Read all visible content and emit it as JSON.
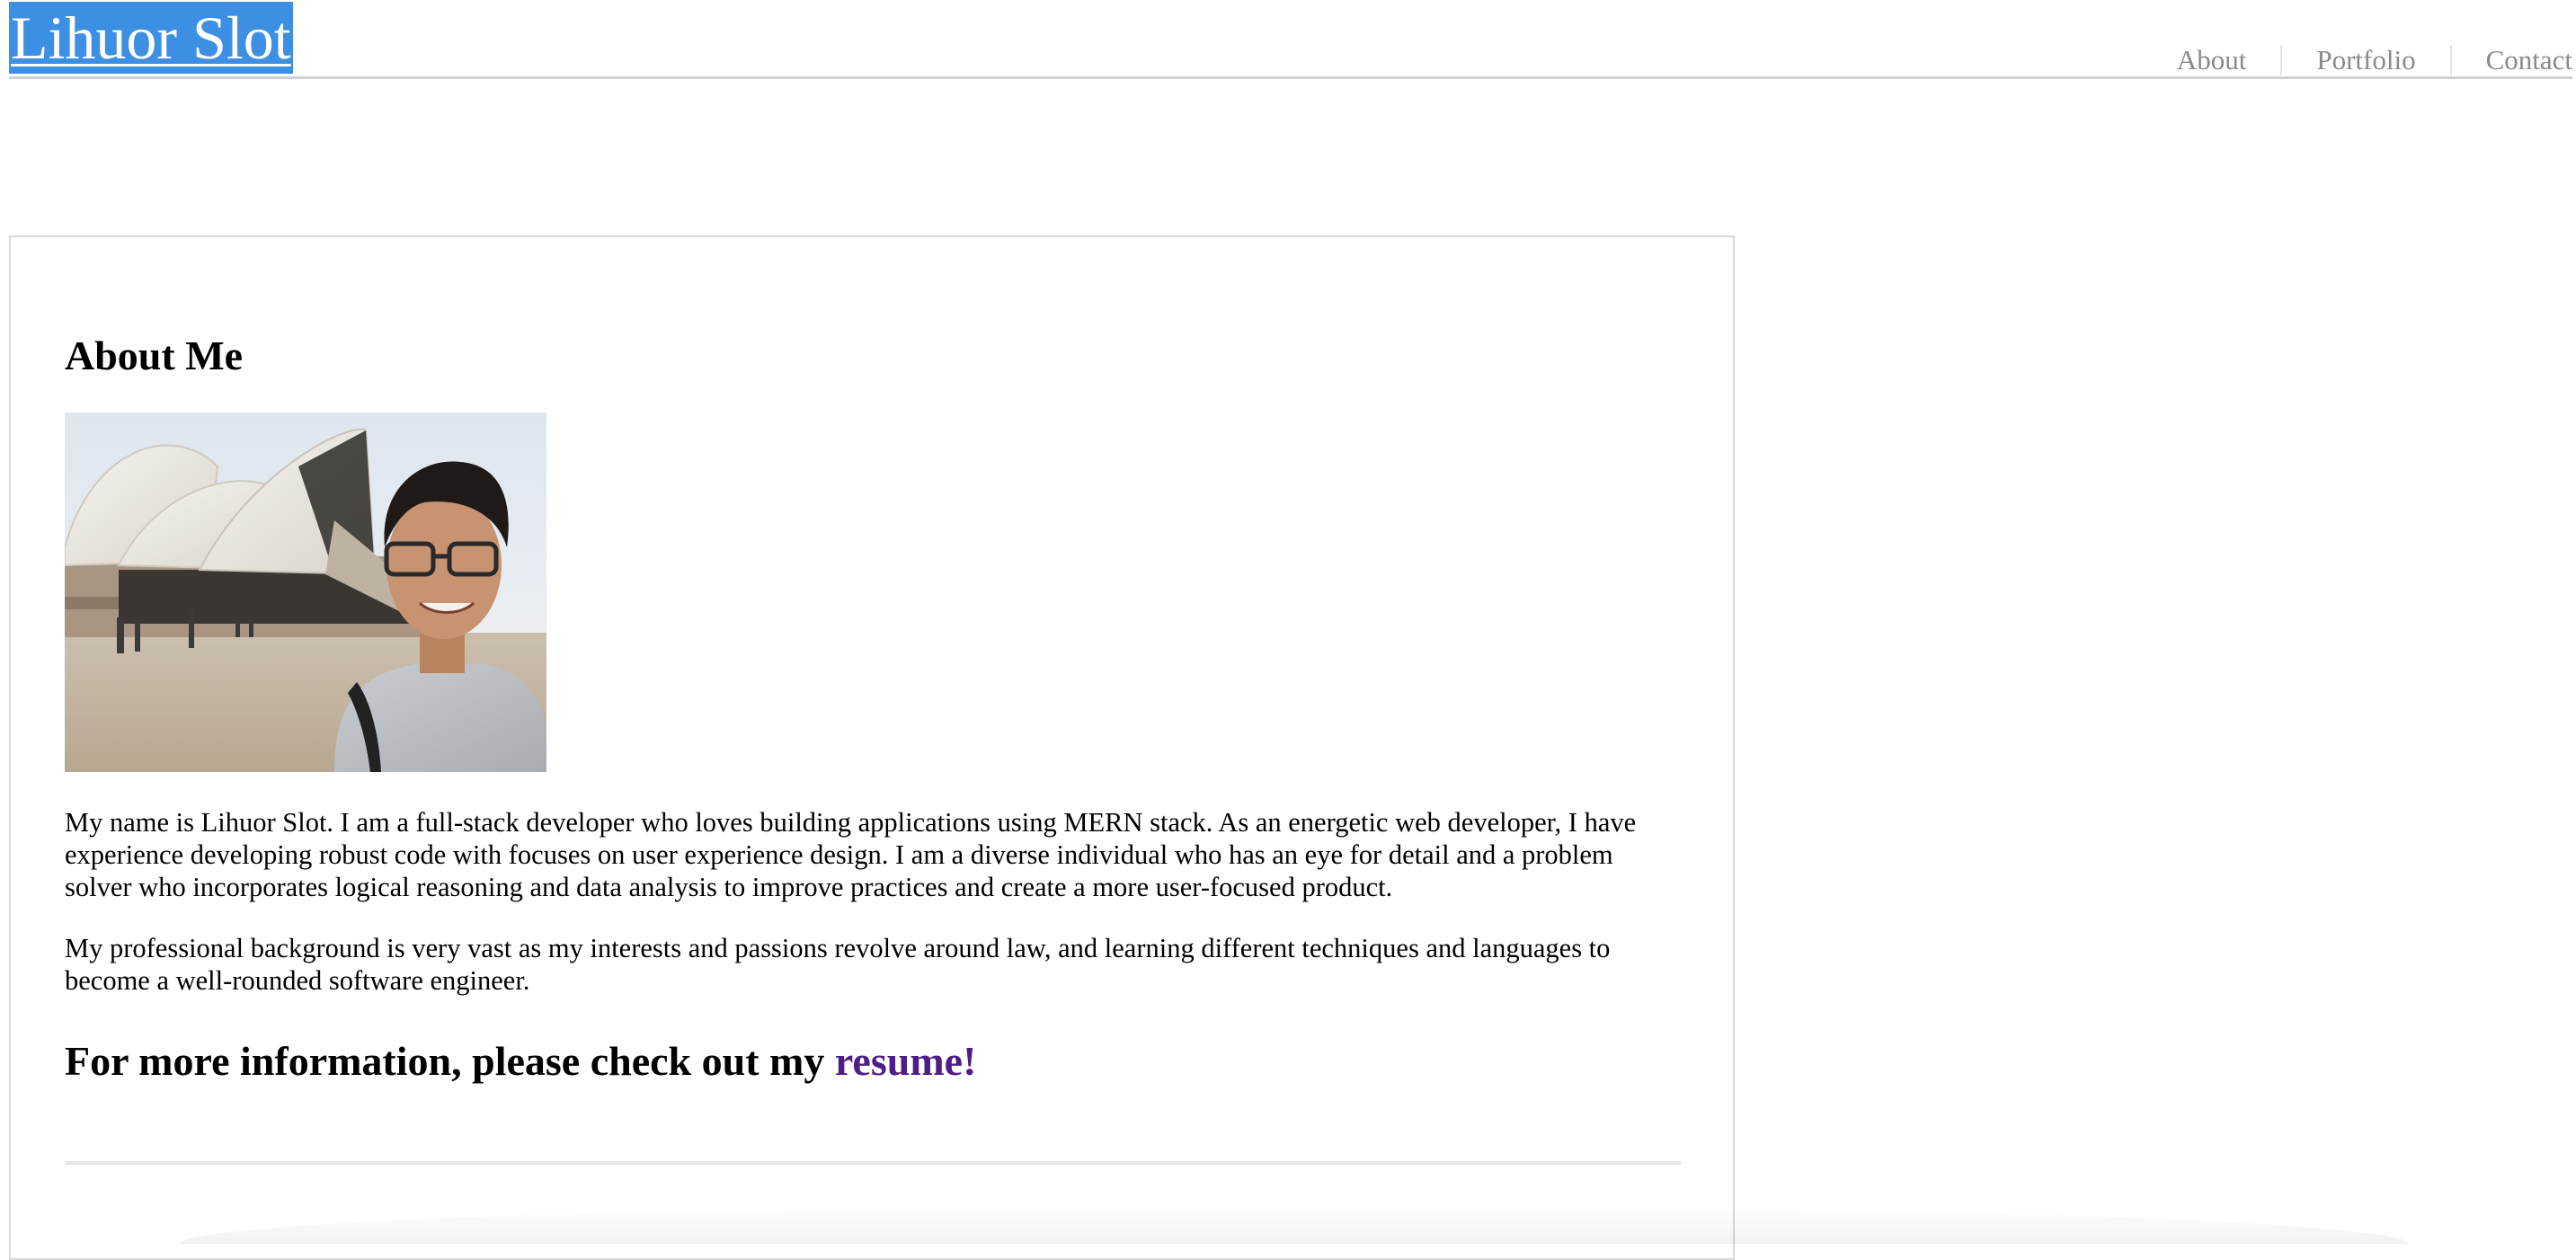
{
  "header": {
    "site_title": "Lihuor Slot",
    "nav": [
      {
        "label": "About"
      },
      {
        "label": "Portfolio"
      },
      {
        "label": "Contact"
      }
    ]
  },
  "about": {
    "heading": "About Me",
    "photo": {
      "icon": "profile-photo-opera-house-selfie"
    },
    "paragraphs": [
      "My name is Lihuor Slot. I am a full-stack developer who loves building applications using MERN stack. As an energetic web developer, I have experience developing robust code with focuses on user experience design. I am a diverse individual who has an eye for detail and a problem solver who incorporates logical reasoning and data analysis to improve practices and create a more user-focused product.",
      "My professional background is very vast as my interests and passions revolve around law, and learning different techniques and languages to become a well-rounded software engineer."
    ],
    "cta_text": "For more information, please check out my ",
    "cta_link": "resume!"
  },
  "colors": {
    "title_background": "#3d8fe3",
    "link_visited": "#4e1d8a",
    "nav_text": "#8a8a8a"
  }
}
